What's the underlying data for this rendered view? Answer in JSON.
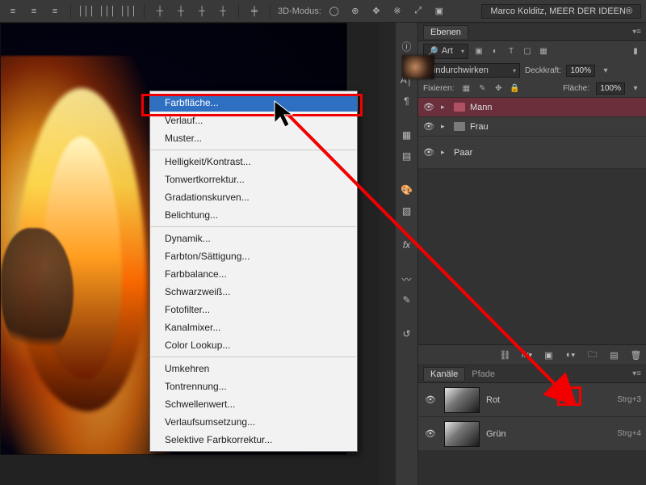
{
  "topbar": {
    "mode_label": "3D-Modus:",
    "login": "Marco Kolditz, MEER DER IDEEN®"
  },
  "context_menu": {
    "groups": [
      [
        "Farbfläche...",
        "Verlauf...",
        "Muster..."
      ],
      [
        "Helligkeit/Kontrast...",
        "Tonwertkorrektur...",
        "Gradationskurven...",
        "Belichtung..."
      ],
      [
        "Dynamik...",
        "Farbton/Sättigung...",
        "Farbbalance...",
        "Schwarzweiß...",
        "Fotofilter...",
        "Kanalmixer...",
        "Color Lookup..."
      ],
      [
        "Umkehren",
        "Tontrennung...",
        "Schwellenwert...",
        "Verlaufsumsetzung...",
        "Selektive Farbkorrektur..."
      ]
    ],
    "hovered": "Farbfläche..."
  },
  "layers_panel": {
    "tab": "Ebenen",
    "filter_label": "Art",
    "blend_mode": "Hindurchwirken",
    "opacity_label": "Deckkraft:",
    "opacity_value": "100%",
    "lock_label": "Fixieren:",
    "fill_label": "Fläche:",
    "fill_value": "100%",
    "layers": [
      {
        "name": "Mann",
        "type": "group",
        "selected": true
      },
      {
        "name": "Frau",
        "type": "group",
        "selected": false
      },
      {
        "name": "Paar",
        "type": "image",
        "selected": false
      }
    ]
  },
  "channels_panel": {
    "tabs": [
      "Kanäle",
      "Pfade"
    ],
    "channels": [
      {
        "name": "Rot",
        "shortcut": "Strg+3"
      },
      {
        "name": "Grün",
        "shortcut": "Strg+4"
      }
    ]
  }
}
